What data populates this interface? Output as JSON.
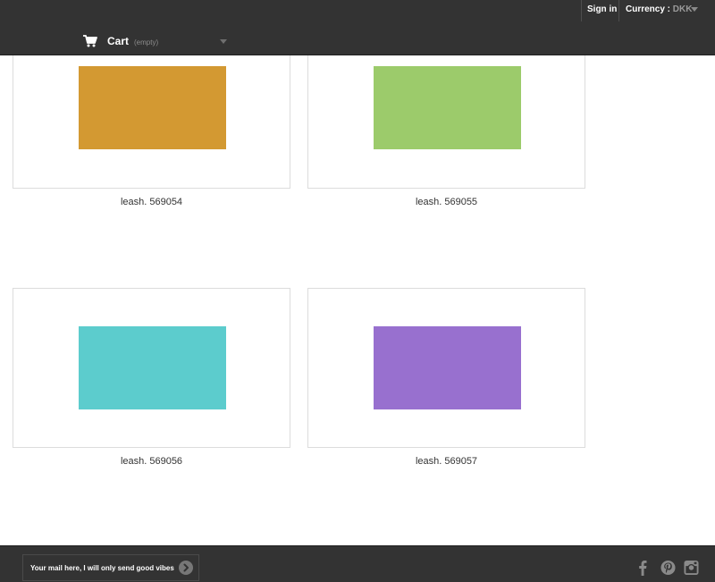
{
  "header": {
    "sign_in_label": "Sign in",
    "currency_label": "Currency :",
    "currency_value": "DKK",
    "cart": {
      "label": "Cart",
      "status": "(empty)",
      "icon": "shopping-cart-icon"
    }
  },
  "products": [
    {
      "name": "leash. 569054",
      "color": "#d39932"
    },
    {
      "name": "leash. 569055",
      "color": "#9ccb6b"
    },
    {
      "name": "leash. 569056",
      "color": "#5ccccd"
    },
    {
      "name": "leash. 569057",
      "color": "#9870cf"
    }
  ],
  "footer": {
    "newsletter_text": "Your mail here, I will only send good vibes",
    "newsletter_button_icon": "arrow-right-icon",
    "social": [
      {
        "name": "facebook",
        "icon": "facebook-icon"
      },
      {
        "name": "pinterest",
        "icon": "pinterest-icon"
      },
      {
        "name": "instagram",
        "icon": "instagram-icon"
      }
    ]
  },
  "colors": {
    "bar_background": "#333333",
    "border": "#dcdcdc",
    "muted_text": "#9a9a9a"
  }
}
